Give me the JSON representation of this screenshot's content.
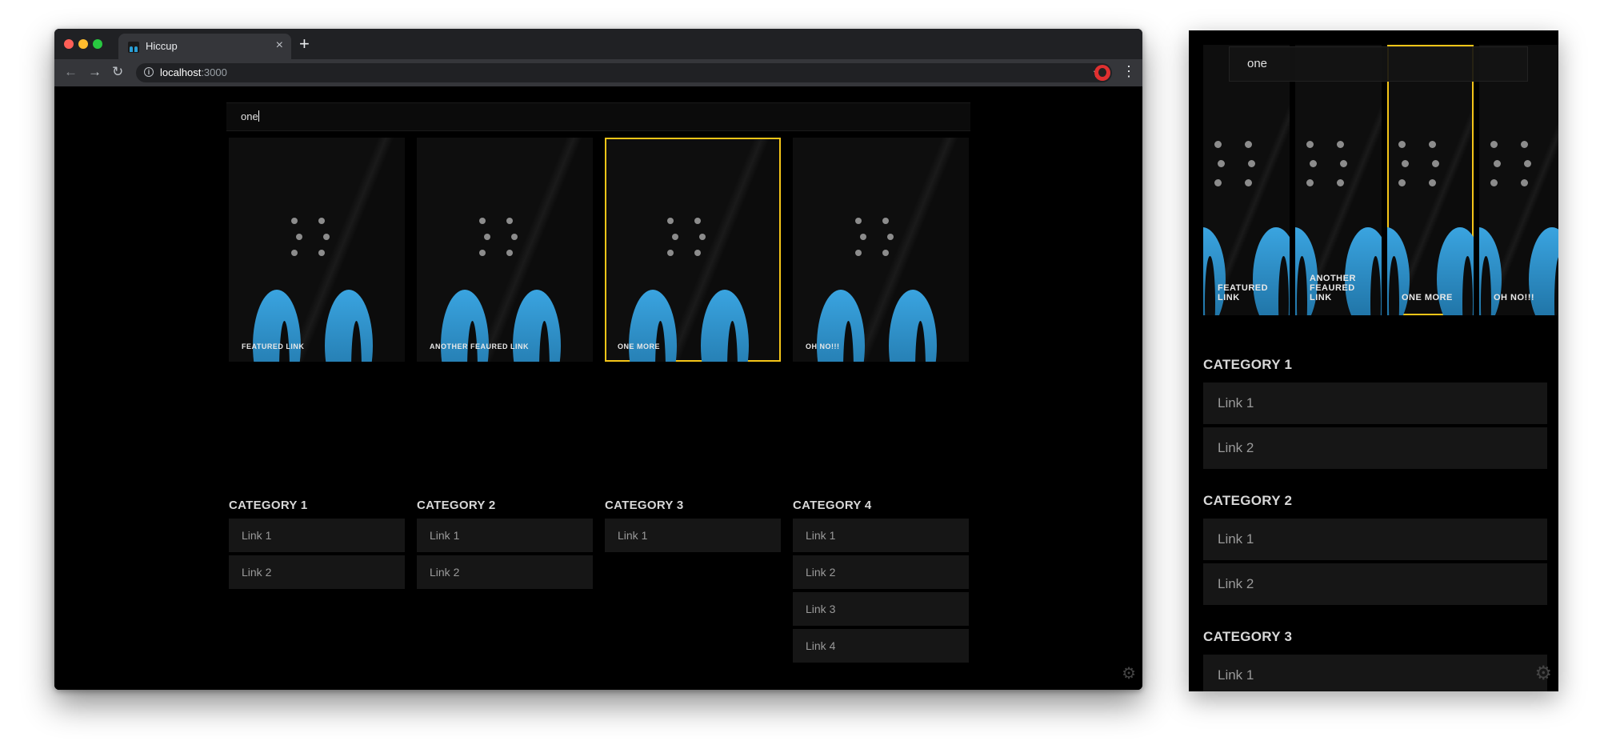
{
  "browser": {
    "tab_title": "Hiccup",
    "tab_close": "×",
    "new_tab": "+",
    "url_host": "localhost",
    "url_port": ":3000",
    "back_icon": "←",
    "forward_icon": "→",
    "reload_icon": "↻",
    "star_icon": "☆",
    "menu_icon": "⋮"
  },
  "desktop": {
    "search_value": "one",
    "featured": [
      {
        "label": "FEATURED LINK",
        "selected": false
      },
      {
        "label": "ANOTHER FEAURED LINK",
        "selected": false
      },
      {
        "label": "ONE MORE",
        "selected": true
      },
      {
        "label": "OH NO!!!",
        "selected": false
      }
    ],
    "categories": [
      {
        "title": "CATEGORY 1",
        "links": [
          "Link 1",
          "Link 2"
        ]
      },
      {
        "title": "CATEGORY 2",
        "links": [
          "Link 1",
          "Link 2"
        ]
      },
      {
        "title": "CATEGORY 3",
        "links": [
          "Link 1"
        ]
      },
      {
        "title": "CATEGORY 4",
        "links": [
          "Link 1",
          "Link 2",
          "Link 3",
          "Link 4"
        ]
      }
    ],
    "settings_icon": "⚙"
  },
  "mobile": {
    "search_value": "one",
    "featured": [
      {
        "label": "FEATURED LINK",
        "selected": false
      },
      {
        "label": "ANOTHER FEAURED LINK",
        "selected": false
      },
      {
        "label": "ONE MORE",
        "selected": true
      },
      {
        "label": "OH NO!!!",
        "selected": false
      }
    ],
    "categories": [
      {
        "title": "CATEGORY 1",
        "links": [
          "Link 1",
          "Link 2"
        ]
      },
      {
        "title": "CATEGORY 2",
        "links": [
          "Link 1",
          "Link 2"
        ]
      },
      {
        "title": "CATEGORY 3",
        "links": [
          "Link 1"
        ]
      }
    ],
    "settings_icon": "⚙"
  },
  "colors": {
    "selected_border": "#f5c518",
    "accent_blue": "#2a9fd6",
    "background": "#000000",
    "link_row": "#161616"
  }
}
